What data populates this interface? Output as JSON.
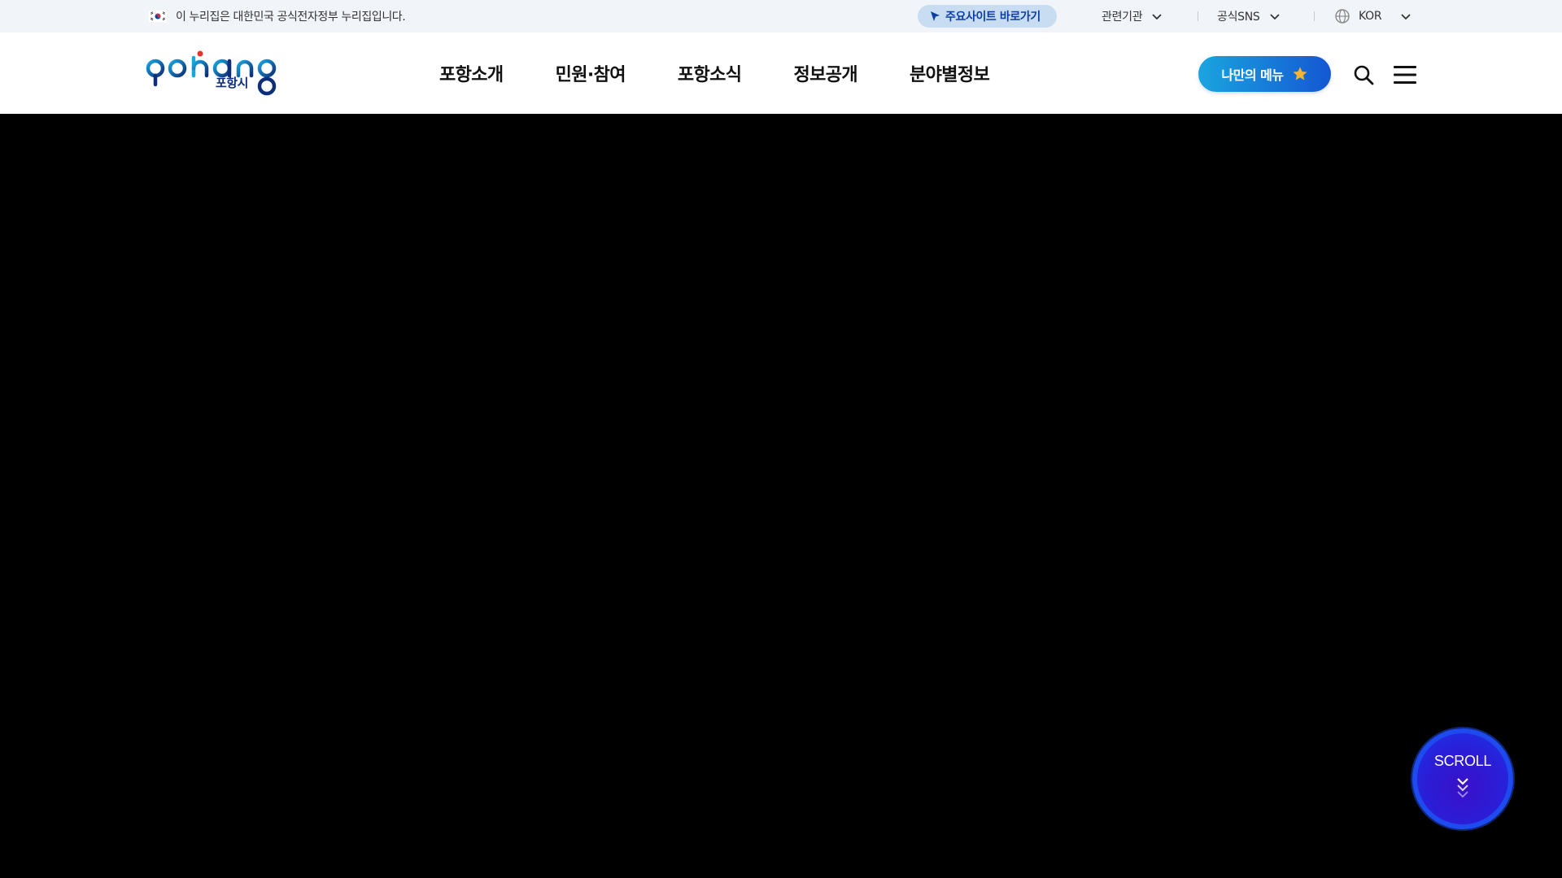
{
  "topbar": {
    "gov_notice": "이 누리집은 대한민국 공식전자정부 누리집입니다.",
    "shortcut_label": "주요사이트 바로가기",
    "related_label": "관련기관",
    "sns_label": "공식SNS",
    "lang_label": "KOR"
  },
  "header": {
    "logo_text": "pohang",
    "logo_sub": "포항시",
    "nav": [
      "포항소개",
      "민원·참여",
      "포항소식",
      "정보공개",
      "분야별정보"
    ],
    "my_menu_label": "나만의 메뉴"
  },
  "scroll_label": "SCROLL",
  "colors": {
    "topbar_bg": "#f1f4f8",
    "pill_bg": "#c8dcf2",
    "brand_blue": "#1457d2",
    "hero_bg": "#000000"
  },
  "icons": [
    "korea-flag-icon",
    "cursor-arrow-icon",
    "chevron-down-icon",
    "globe-icon",
    "star-icon",
    "search-icon",
    "hamburger-icon",
    "double-chevron-down-icon"
  ]
}
